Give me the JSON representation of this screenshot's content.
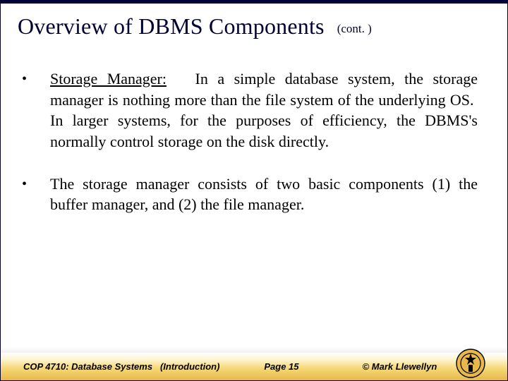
{
  "header": {
    "title": "Overview of DBMS Components",
    "cont": "(cont. )"
  },
  "bullets": [
    {
      "term": "Storage Manager:",
      "gap": "   ",
      "text": "In a simple database system, the storage manager is nothing more than the file system of the underlying OS.  In larger systems, for the purposes of efficiency, the DBMS's normally control storage on the disk directly."
    },
    {
      "term": "",
      "gap": "",
      "text": "The storage manager consists of two basic components (1) the buffer manager, and (2) the file manager."
    }
  ],
  "footer": {
    "course": "COP 4710: Database Systems",
    "section": "(Introduction)",
    "page": "Page 15",
    "copyright": "© Mark Llewellyn"
  }
}
